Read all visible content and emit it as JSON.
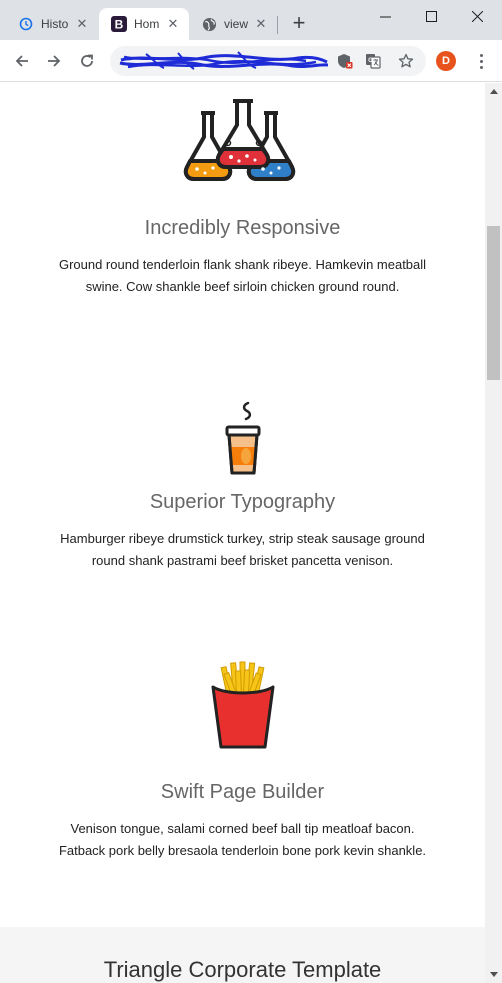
{
  "browser": {
    "tabs": [
      {
        "title": "Histo",
        "icon": "history-icon",
        "active": false
      },
      {
        "title": "Hom",
        "icon": "bootstrap-favicon-icon",
        "active": true
      },
      {
        "title": "view",
        "icon": "globe-icon",
        "active": false
      }
    ],
    "profile_initial": "D",
    "colors": {
      "tabstrip": "#dee1e6",
      "avatar": "#e8531d"
    }
  },
  "features": [
    {
      "icon": "lab-flasks-icon",
      "title": "Incredibly Responsive",
      "text": "Ground round tenderloin flank shank ribeye. Hamkevin meatball swine. Cow shankle beef sirloin chicken ground round."
    },
    {
      "icon": "coffee-cup-icon",
      "title": "Superior Typography",
      "text": "Hamburger ribeye drumstick turkey, strip steak sausage ground round shank pastrami beef brisket pancetta venison."
    },
    {
      "icon": "french-fries-icon",
      "title": "Swift Page Builder",
      "text": "Venison tongue, salami corned beef ball tip meatloaf bacon. Fatback pork belly bresaola tenderloin bone pork kevin shankle."
    }
  ],
  "section": {
    "heading": "Triangle Corporate Template"
  }
}
